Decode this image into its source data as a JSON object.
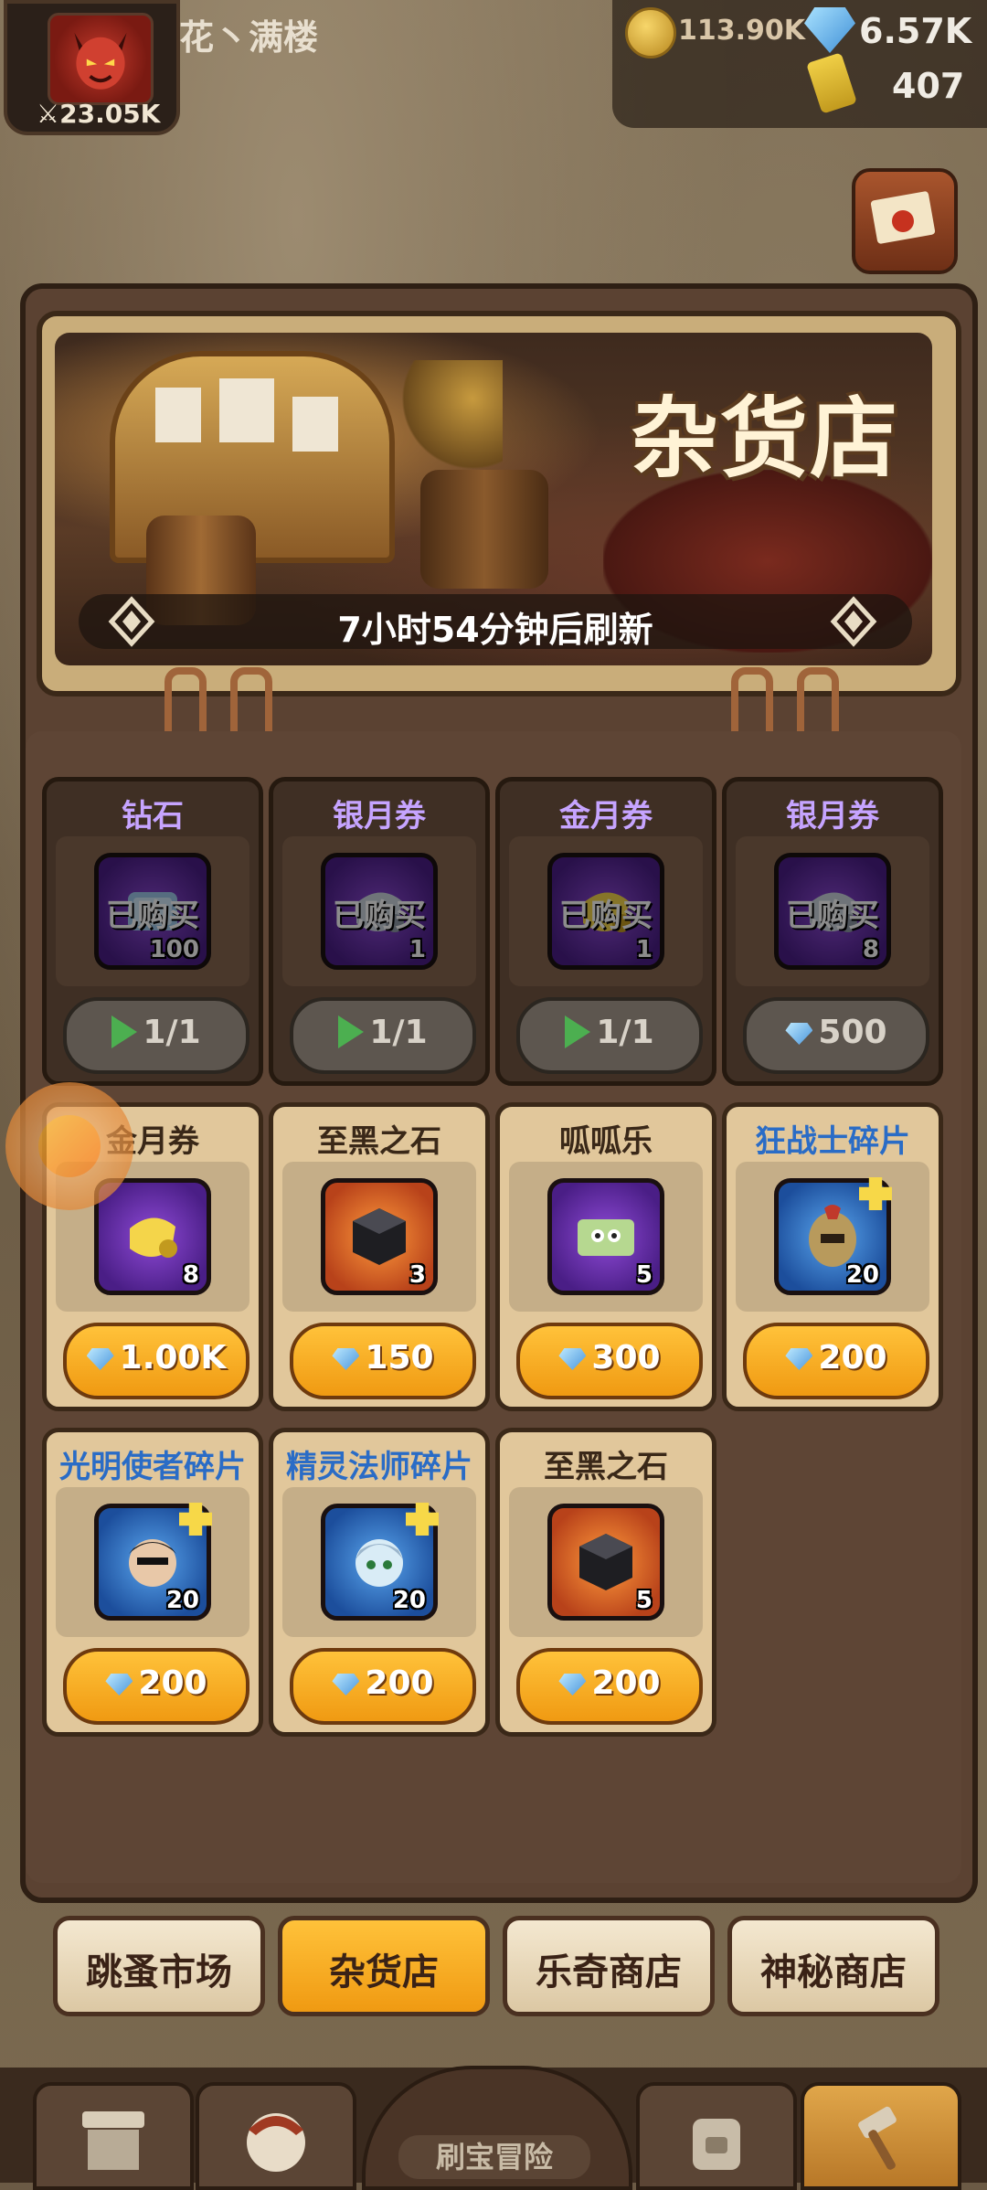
{
  "player": {
    "name": "花丶满楼",
    "power": "23.05K",
    "avatar": "demon-avatar"
  },
  "currencies": {
    "gold": "113.90K",
    "gems": "6.57K",
    "tickets": "407"
  },
  "shop": {
    "title": "杂货店",
    "refresh": "7小时54分钟后刷新"
  },
  "items": [
    {
      "name": "钻石",
      "qty": "100",
      "status": "已购买",
      "price": "1/1",
      "price_type": "ad",
      "icon": "scroll-icon",
      "frame": "purple"
    },
    {
      "name": "银月券",
      "qty": "1",
      "status": "已购买",
      "price": "1/1",
      "price_type": "ad",
      "icon": "silver-scroll-icon",
      "frame": "purple"
    },
    {
      "name": "金月券",
      "qty": "1",
      "status": "已购买",
      "price": "1/1",
      "price_type": "ad",
      "icon": "gold-scroll-icon",
      "frame": "purple"
    },
    {
      "name": "银月券",
      "qty": "8",
      "status": "已购买",
      "price": "500",
      "price_type": "gem",
      "icon": "silver-scroll-icon",
      "frame": "purple"
    },
    {
      "name": "金月券",
      "qty": "8",
      "price": "1.00K",
      "price_type": "gem",
      "icon": "gold-scroll-icon",
      "frame": "purple"
    },
    {
      "name": "至黑之石",
      "qty": "3",
      "price": "150",
      "price_type": "gem",
      "icon": "black-cube-icon",
      "frame": "orange"
    },
    {
      "name": "呱呱乐",
      "qty": "5",
      "price": "300",
      "price_type": "gem",
      "icon": "frog-ticket-icon",
      "frame": "purple"
    },
    {
      "name": "狂战士碎片",
      "qty": "20",
      "price": "200",
      "price_type": "gem",
      "icon": "berserker-icon",
      "frame": "blue"
    },
    {
      "name": "光明使者碎片",
      "qty": "20",
      "price": "200",
      "price_type": "gem",
      "icon": "light-envoy-icon",
      "frame": "blue"
    },
    {
      "name": "精灵法师碎片",
      "qty": "20",
      "price": "200",
      "price_type": "gem",
      "icon": "elf-mage-icon",
      "frame": "blue"
    },
    {
      "name": "至黑之石",
      "qty": "5",
      "price": "200",
      "price_type": "gem",
      "icon": "black-cube-icon",
      "frame": "orange"
    }
  ],
  "tabs": [
    "跳蚤市场",
    "杂货店",
    "乐奇商店",
    "神秘商店"
  ],
  "active_tab": "杂货店",
  "bottom_nav": {
    "center_label": "刷宝冒险"
  },
  "colors": {
    "accent": "#f09a12",
    "sold_title": "#c6a4ff",
    "hero_title": "#2a6cc6",
    "panel": "#5b4232"
  }
}
